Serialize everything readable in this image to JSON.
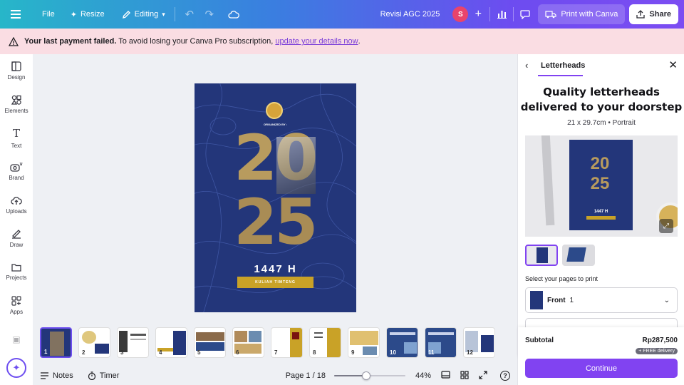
{
  "topbar": {
    "file": "File",
    "resize": "Resize",
    "editing": "Editing",
    "doc_title": "Revisi AGC 2025",
    "avatar_initial": "S",
    "print": "Print with Canva",
    "share": "Share"
  },
  "banner": {
    "bold": "Your last payment failed.",
    "text": " To avoid losing your Canva Pro subscription, ",
    "link": "update your details now",
    "end": "."
  },
  "sidebar": {
    "items": [
      "Design",
      "Elements",
      "Text",
      "Brand",
      "Uploads",
      "Draw",
      "Projects",
      "Apps"
    ]
  },
  "design": {
    "organized_by": "ORGANIZED BY :",
    "digits_top": "20",
    "digits_bottom": "25",
    "hijri": "1447 H",
    "ribbon": "KULIAH TIMTENG"
  },
  "pages": [
    "1",
    "2",
    "3",
    "4",
    "5",
    "6",
    "7",
    "8",
    "9",
    "10",
    "11",
    "12"
  ],
  "bottombar": {
    "notes": "Notes",
    "timer": "Timer",
    "page": "Page 1 / 18",
    "zoom_value": 0.44,
    "zoom": "44%"
  },
  "panel": {
    "tab": "Letterheads",
    "title_line1": "Quality letterheads",
    "title_line2": "delivered to your doorstep",
    "spec": "21 x 29.7cm • Portrait",
    "preview_digits": "20 25",
    "preview_hijri": "1447 H",
    "select_label": "Select your pages to print",
    "select_name": "Front",
    "select_count": "1",
    "subtotal_label": "Subtotal",
    "subtotal_value": "Rp287,500",
    "delivery": "+ FREE delivery",
    "continue": "Continue"
  },
  "colors": {
    "accent": "#8143f1",
    "design_bg": "#23367a",
    "gold": "#c9a227",
    "banner_bg": "#fadde3"
  }
}
